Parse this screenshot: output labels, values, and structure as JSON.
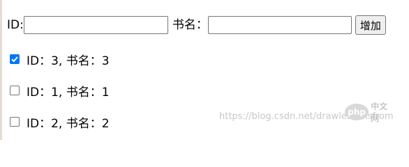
{
  "form": {
    "id_label": "ID:",
    "id_value": "",
    "name_label": "书名：",
    "name_value": "",
    "add_button_label": "增加"
  },
  "books": [
    {
      "checked": true,
      "text": "ID：3, 书名：3"
    },
    {
      "checked": false,
      "text": "ID：1, 书名：1"
    },
    {
      "checked": false,
      "text": "ID：2, 书名：2"
    }
  ],
  "watermark": {
    "url": "https://blog.csdn.net/drawlessonsfrom",
    "logo": "php",
    "logo_cn": "中文网"
  },
  "colors": {
    "checkbox_checked": "#0075ff",
    "button_bg": "#efefef"
  }
}
